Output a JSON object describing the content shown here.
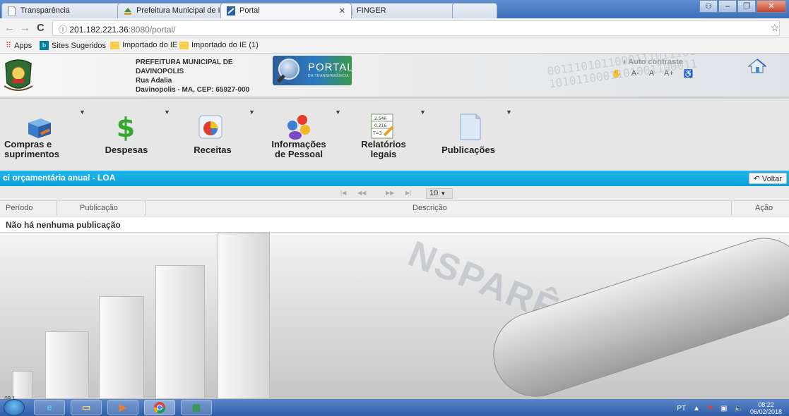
{
  "browser": {
    "tabs": [
      {
        "title": "Transparência",
        "active": false
      },
      {
        "title": "Prefeitura Municipal de I",
        "active": false
      },
      {
        "title": "Portal",
        "active": true
      },
      {
        "title": "FINGER",
        "active": false
      }
    ],
    "url_host": "201.182.221.36",
    "url_rest": ":8080/portal/",
    "bookmarks": [
      "Apps",
      "Sites Sugeridos",
      "Importado do IE",
      "Importado do IE (1)"
    ]
  },
  "header": {
    "org_line1": "PREFEITURA MUNICIPAL DE",
    "org_line2": "DAVINOPOLIS",
    "org_line3": "Rua Adalia",
    "org_line4": "Davinopolis - MA, CEP: 65927-000",
    "logo_title": "PORTAL",
    "logo_subtitle": "DA TRANSPARÊNCIA",
    "contrast_label": "Auto contraste",
    "font_small": "A-",
    "font_normal": "A",
    "font_large": "A+"
  },
  "menu": {
    "items": [
      {
        "line1": "Compras e",
        "line2": "suprimentos"
      },
      {
        "line1": "Despesas",
        "line2": ""
      },
      {
        "line1": "Receitas",
        "line2": ""
      },
      {
        "line1": "Informações",
        "line2": "de Pessoal"
      },
      {
        "line1": "Relatórios",
        "line2": "legais"
      },
      {
        "line1": "Publicações",
        "line2": ""
      }
    ]
  },
  "section": {
    "title": "ei orçamentária anual - LOA",
    "back_button": "Voltar"
  },
  "pager": {
    "page_size": "10"
  },
  "table": {
    "columns": [
      "Período",
      "Publicação",
      "Descrição",
      "Ação"
    ],
    "empty_message": "Não há nenhuma publicação"
  },
  "footer": {
    "version": ".09.1"
  },
  "taskbar": {
    "language": "PT",
    "time": "08:22",
    "date": "06/02/2018"
  }
}
